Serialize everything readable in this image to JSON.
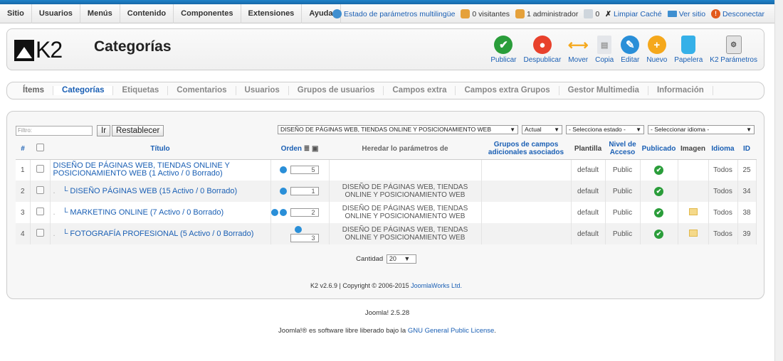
{
  "menubar": {
    "items": [
      "Sitio",
      "Usuarios",
      "Menús",
      "Contenido",
      "Componentes",
      "Extensiones",
      "Ayuda"
    ],
    "status": {
      "multilang": "Estado de parámetros multilingüe",
      "visitors": "0 visitantes",
      "admins": "1 administrador",
      "messages": "0",
      "clear_cache": "Limpiar Caché",
      "view_site": "Ver sitio",
      "logout": "Desconectar"
    }
  },
  "header": {
    "logo": "K2",
    "title": "Categorías",
    "toolbar": [
      {
        "label": "Publicar",
        "icon": "check-icon",
        "color": "#2a9d3a"
      },
      {
        "label": "Despublicar",
        "icon": "stop-icon",
        "color": "#e8412c"
      },
      {
        "label": "Mover",
        "icon": "move-icon",
        "color": "#f5a81c"
      },
      {
        "label": "Copia",
        "icon": "copy-icon",
        "color": "#c9ccd1"
      },
      {
        "label": "Editar",
        "icon": "edit-icon",
        "color": "#2a8fd8"
      },
      {
        "label": "Nuevo",
        "icon": "plus-icon",
        "color": "#f5a81c"
      },
      {
        "label": "Papelera",
        "icon": "trash-icon",
        "color": "#35b0e8"
      },
      {
        "label": "K2 Parámetros",
        "icon": "params-icon",
        "color": "#d8d8d8"
      }
    ]
  },
  "tabs": [
    "Ítems",
    "Categorías",
    "Etiquetas",
    "Comentarios",
    "Usuarios",
    "Grupos de usuarios",
    "Campos extra",
    "Campos extra Grupos",
    "Gestor Multimedia",
    "Información"
  ],
  "filter": {
    "placeholder": "Filtro:",
    "go": "Ir",
    "reset": "Restablecer",
    "category": "DISEÑO DE PÁGINAS WEB, TIENDAS ONLINE Y POSICIONAMIENTO WEB",
    "level": "Actual",
    "state": "- Selecciona estado -",
    "language": "- Seleccionar idioma -"
  },
  "table": {
    "headers": {
      "num": "#",
      "title": "Título",
      "order": "Orden",
      "inherit": "Heredar lo parámetros de",
      "groups": "Grupos de campos adicionales asociados",
      "template": "Plantilla",
      "access": "Nivel de Acceso",
      "published": "Publicado",
      "image": "Imagen",
      "language": "Idioma",
      "id": "ID"
    },
    "rows": [
      {
        "num": "1",
        "title": "DISEÑO DE PÁGINAS WEB, TIENDAS ONLINE Y POSICIONAMIENTO WEB (1 Activo / 0 Borrado)",
        "order": "5",
        "inherit": "",
        "template": "default",
        "access": "Public",
        "language": "Todos",
        "id": "25"
      },
      {
        "num": "2",
        "title": "└ DISEÑO PÁGINAS WEB (15 Activo / 0 Borrado)",
        "order": "1",
        "inherit": "DISEÑO DE PÁGINAS WEB, TIENDAS ONLINE Y POSICIONAMIENTO WEB",
        "template": "default",
        "access": "Public",
        "language": "Todos",
        "id": "34"
      },
      {
        "num": "3",
        "title": "└ MARKETING ONLINE (7 Activo / 0 Borrado)",
        "order": "2",
        "inherit": "DISEÑO DE PÁGINAS WEB, TIENDAS ONLINE Y POSICIONAMIENTO WEB",
        "template": "default",
        "access": "Public",
        "language": "Todos",
        "id": "38"
      },
      {
        "num": "4",
        "title": "└ FOTOGRAFÍA PROFESIONAL (5 Activo / 0 Borrado)",
        "order": "3",
        "inherit": "DISEÑO DE PÁGINAS WEB, TIENDAS ONLINE Y POSICIONAMIENTO WEB",
        "template": "default",
        "access": "Public",
        "language": "Todos",
        "id": "39"
      }
    ]
  },
  "pagination": {
    "label": "Cantidad",
    "value": "20"
  },
  "copyright": {
    "prefix": "K2 v2.6.9 | Copyright © 2006-2015 ",
    "link": "JoomlaWorks Ltd."
  },
  "footer": {
    "version": "Joomla! 2.5.28",
    "license_prefix": "Joomla!® es software libre liberado bajo la ",
    "license_link": "GNU General Public License",
    "license_suffix": "."
  }
}
